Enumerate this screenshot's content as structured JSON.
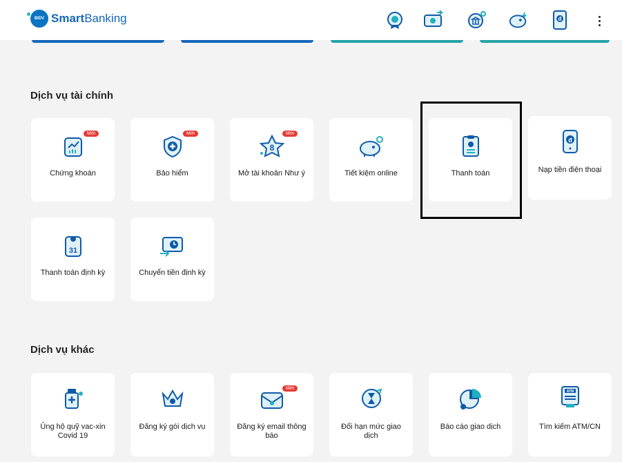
{
  "app": {
    "logo_badge": "BIDV",
    "name_bold": "Smart",
    "name_rest": "Banking"
  },
  "header_icons": [
    "medal-icon",
    "money-transfer-icon",
    "bank-payment-icon",
    "piggy-bank-icon",
    "mobile-topup-icon"
  ],
  "sections": {
    "financial": {
      "title": "Dịch vụ tài chính",
      "tiles": [
        {
          "label": "Chứng khoán",
          "badge": "Mới",
          "icon": "stock-chart-icon"
        },
        {
          "label": "Bảo hiểm",
          "badge": "Mới",
          "icon": "insurance-shield-icon"
        },
        {
          "label": "Mở tài khoản Như ý",
          "badge": "Mới",
          "icon": "star-account-icon"
        },
        {
          "label": "Tiết kiệm online",
          "icon": "piggy-bank-icon"
        },
        {
          "label": "Thanh toán",
          "icon": "bill-payment-icon"
        },
        {
          "label": "Nạp tiền điện thoại",
          "icon": "mobile-topup-icon"
        },
        {
          "label": "Thanh toán định kỳ",
          "icon": "calendar-31-icon",
          "calendar_day": "31"
        },
        {
          "label": "Chuyển tiền định kỳ",
          "icon": "scheduled-transfer-icon"
        }
      ]
    },
    "other": {
      "title": "Dịch vụ khác",
      "tiles": [
        {
          "label": "Ủng hộ quỹ vac-xin Covid 19",
          "icon": "vaccine-icon"
        },
        {
          "label": "Đăng ký gói dịch vụ",
          "icon": "crown-package-icon"
        },
        {
          "label": "Đăng ký email thông báo",
          "badge": "Mới",
          "icon": "email-notify-icon"
        },
        {
          "label": "Đổi hạn mức giao dịch",
          "icon": "limit-hourglass-icon"
        },
        {
          "label": "Báo cáo giao dịch",
          "icon": "pie-report-icon"
        },
        {
          "label": "Tìm kiếm ATM/CN",
          "icon": "atm-icon",
          "atm_text": "ATM"
        }
      ]
    }
  },
  "colors": {
    "brand_blue": "#1566b8",
    "icon_blue": "#0f5aa8",
    "icon_teal": "#21b0c2",
    "badge_red": "#e53935"
  }
}
